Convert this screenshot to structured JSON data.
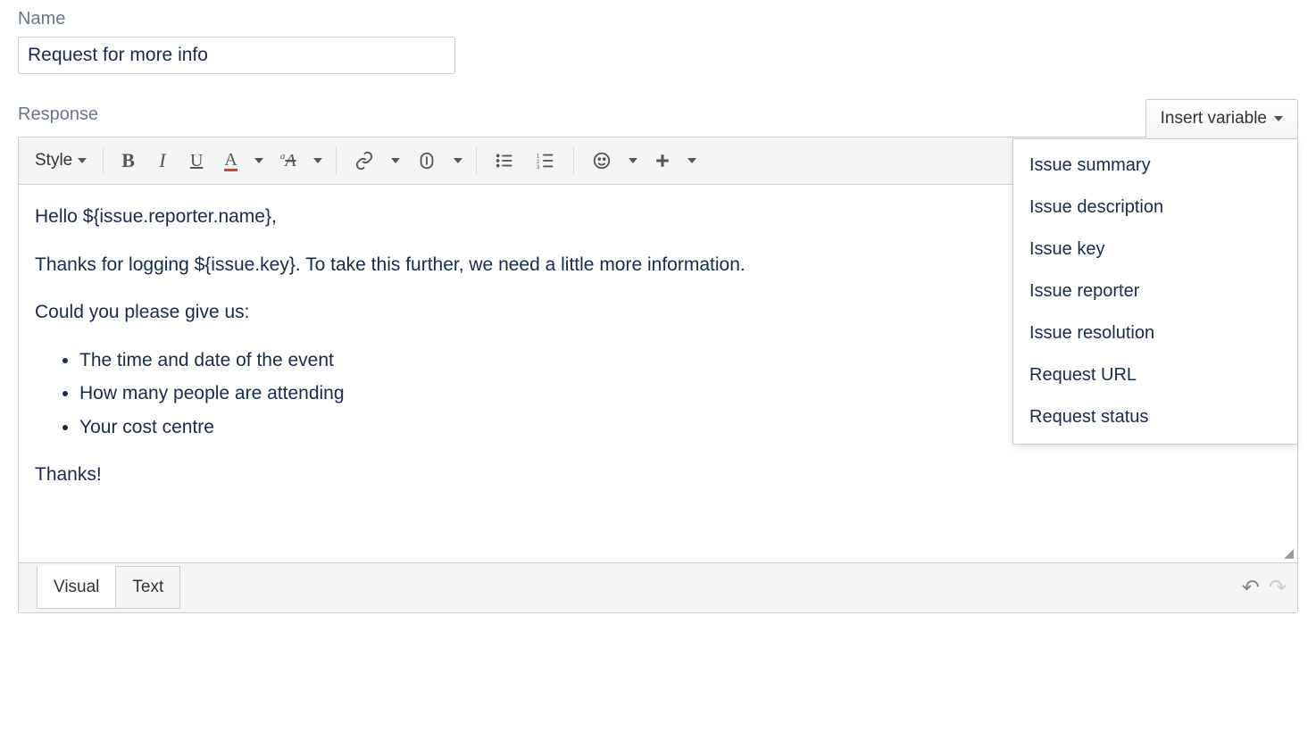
{
  "labels": {
    "name": "Name",
    "response": "Response",
    "insert_variable": "Insert variable",
    "style": "Style",
    "visual_tab": "Visual",
    "text_tab": "Text"
  },
  "form": {
    "name_value": "Request for more info"
  },
  "variable_menu": [
    "Issue summary",
    "Issue description",
    "Issue key",
    "Issue reporter",
    "Issue resolution",
    "Request URL",
    "Request status"
  ],
  "response_body": {
    "p1": "Hello ${issue.reporter.name},",
    "p2": "Thanks for logging ${issue.key}. To take this further, we need a little more information.",
    "p3": "Could you please give us:",
    "bullets": [
      "The time and date of the event",
      "How many people are attending",
      "Your cost centre"
    ],
    "p4": "Thanks!"
  }
}
